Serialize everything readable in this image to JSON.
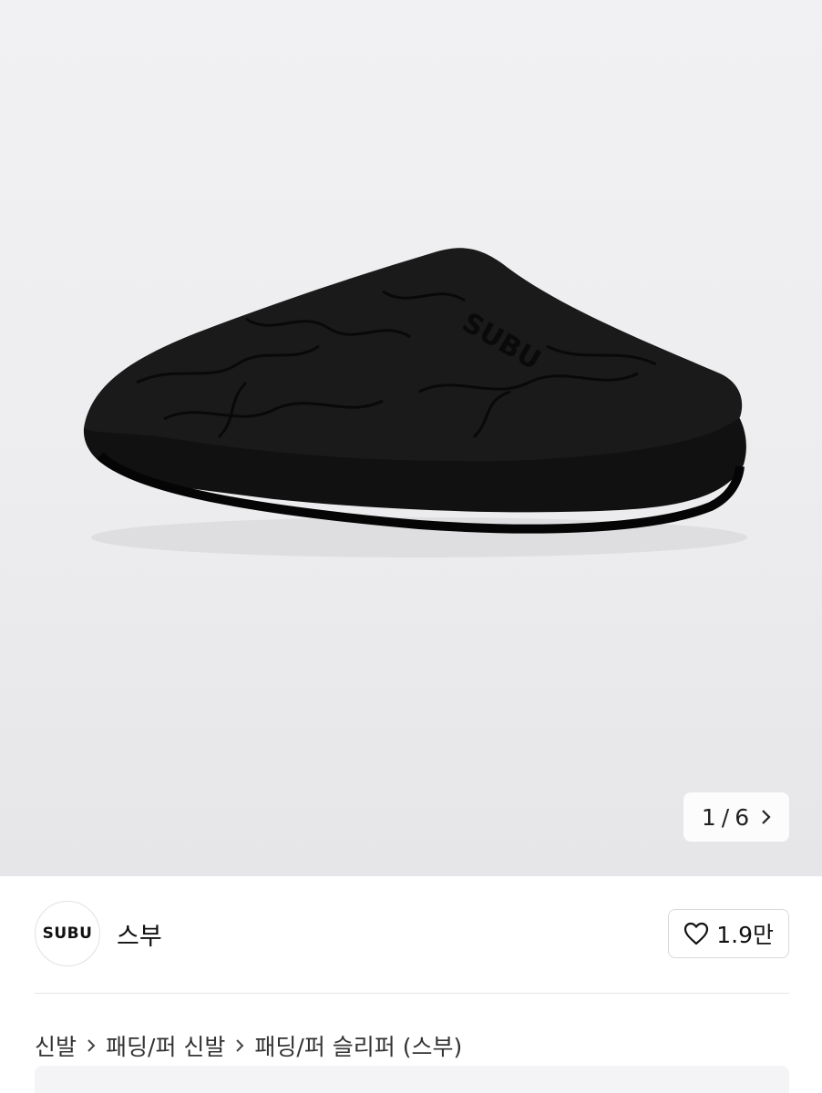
{
  "gallery": {
    "product_image": "black-quilted-padded-slipper",
    "logo_on_product": "SUBU",
    "counter": {
      "current": "1",
      "separator": "/",
      "total": "6",
      "next_icon": "chevron-right-icon"
    }
  },
  "brand": {
    "logo_text": "SUBU",
    "name": "스부"
  },
  "like": {
    "icon": "heart-outline-icon",
    "count": "1.9만"
  },
  "breadcrumb": {
    "items": [
      "신발",
      "패딩/퍼 신발",
      "패딩/퍼 슬리퍼 (스부)"
    ],
    "separator_icon": "chevron-right-icon"
  }
}
